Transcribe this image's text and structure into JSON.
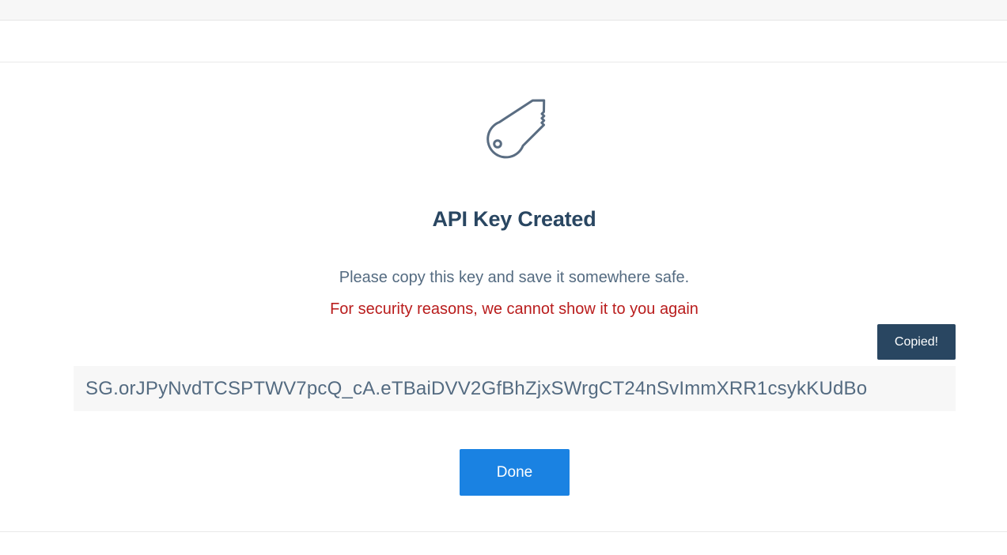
{
  "modal": {
    "icon": "key-icon",
    "title": "API Key Created",
    "message": "Please copy this key and save it somewhere safe.",
    "warning": "For security reasons, we cannot show it to you again",
    "tooltip": "Copied!",
    "api_key": "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",
    "done_label": "Done"
  },
  "colors": {
    "title": "#294661",
    "text": "#546b81",
    "warning": "#b91c1c",
    "tooltip_bg": "#294661",
    "button_bg": "#1a82e2",
    "key_box_bg": "#f7f7f7"
  }
}
